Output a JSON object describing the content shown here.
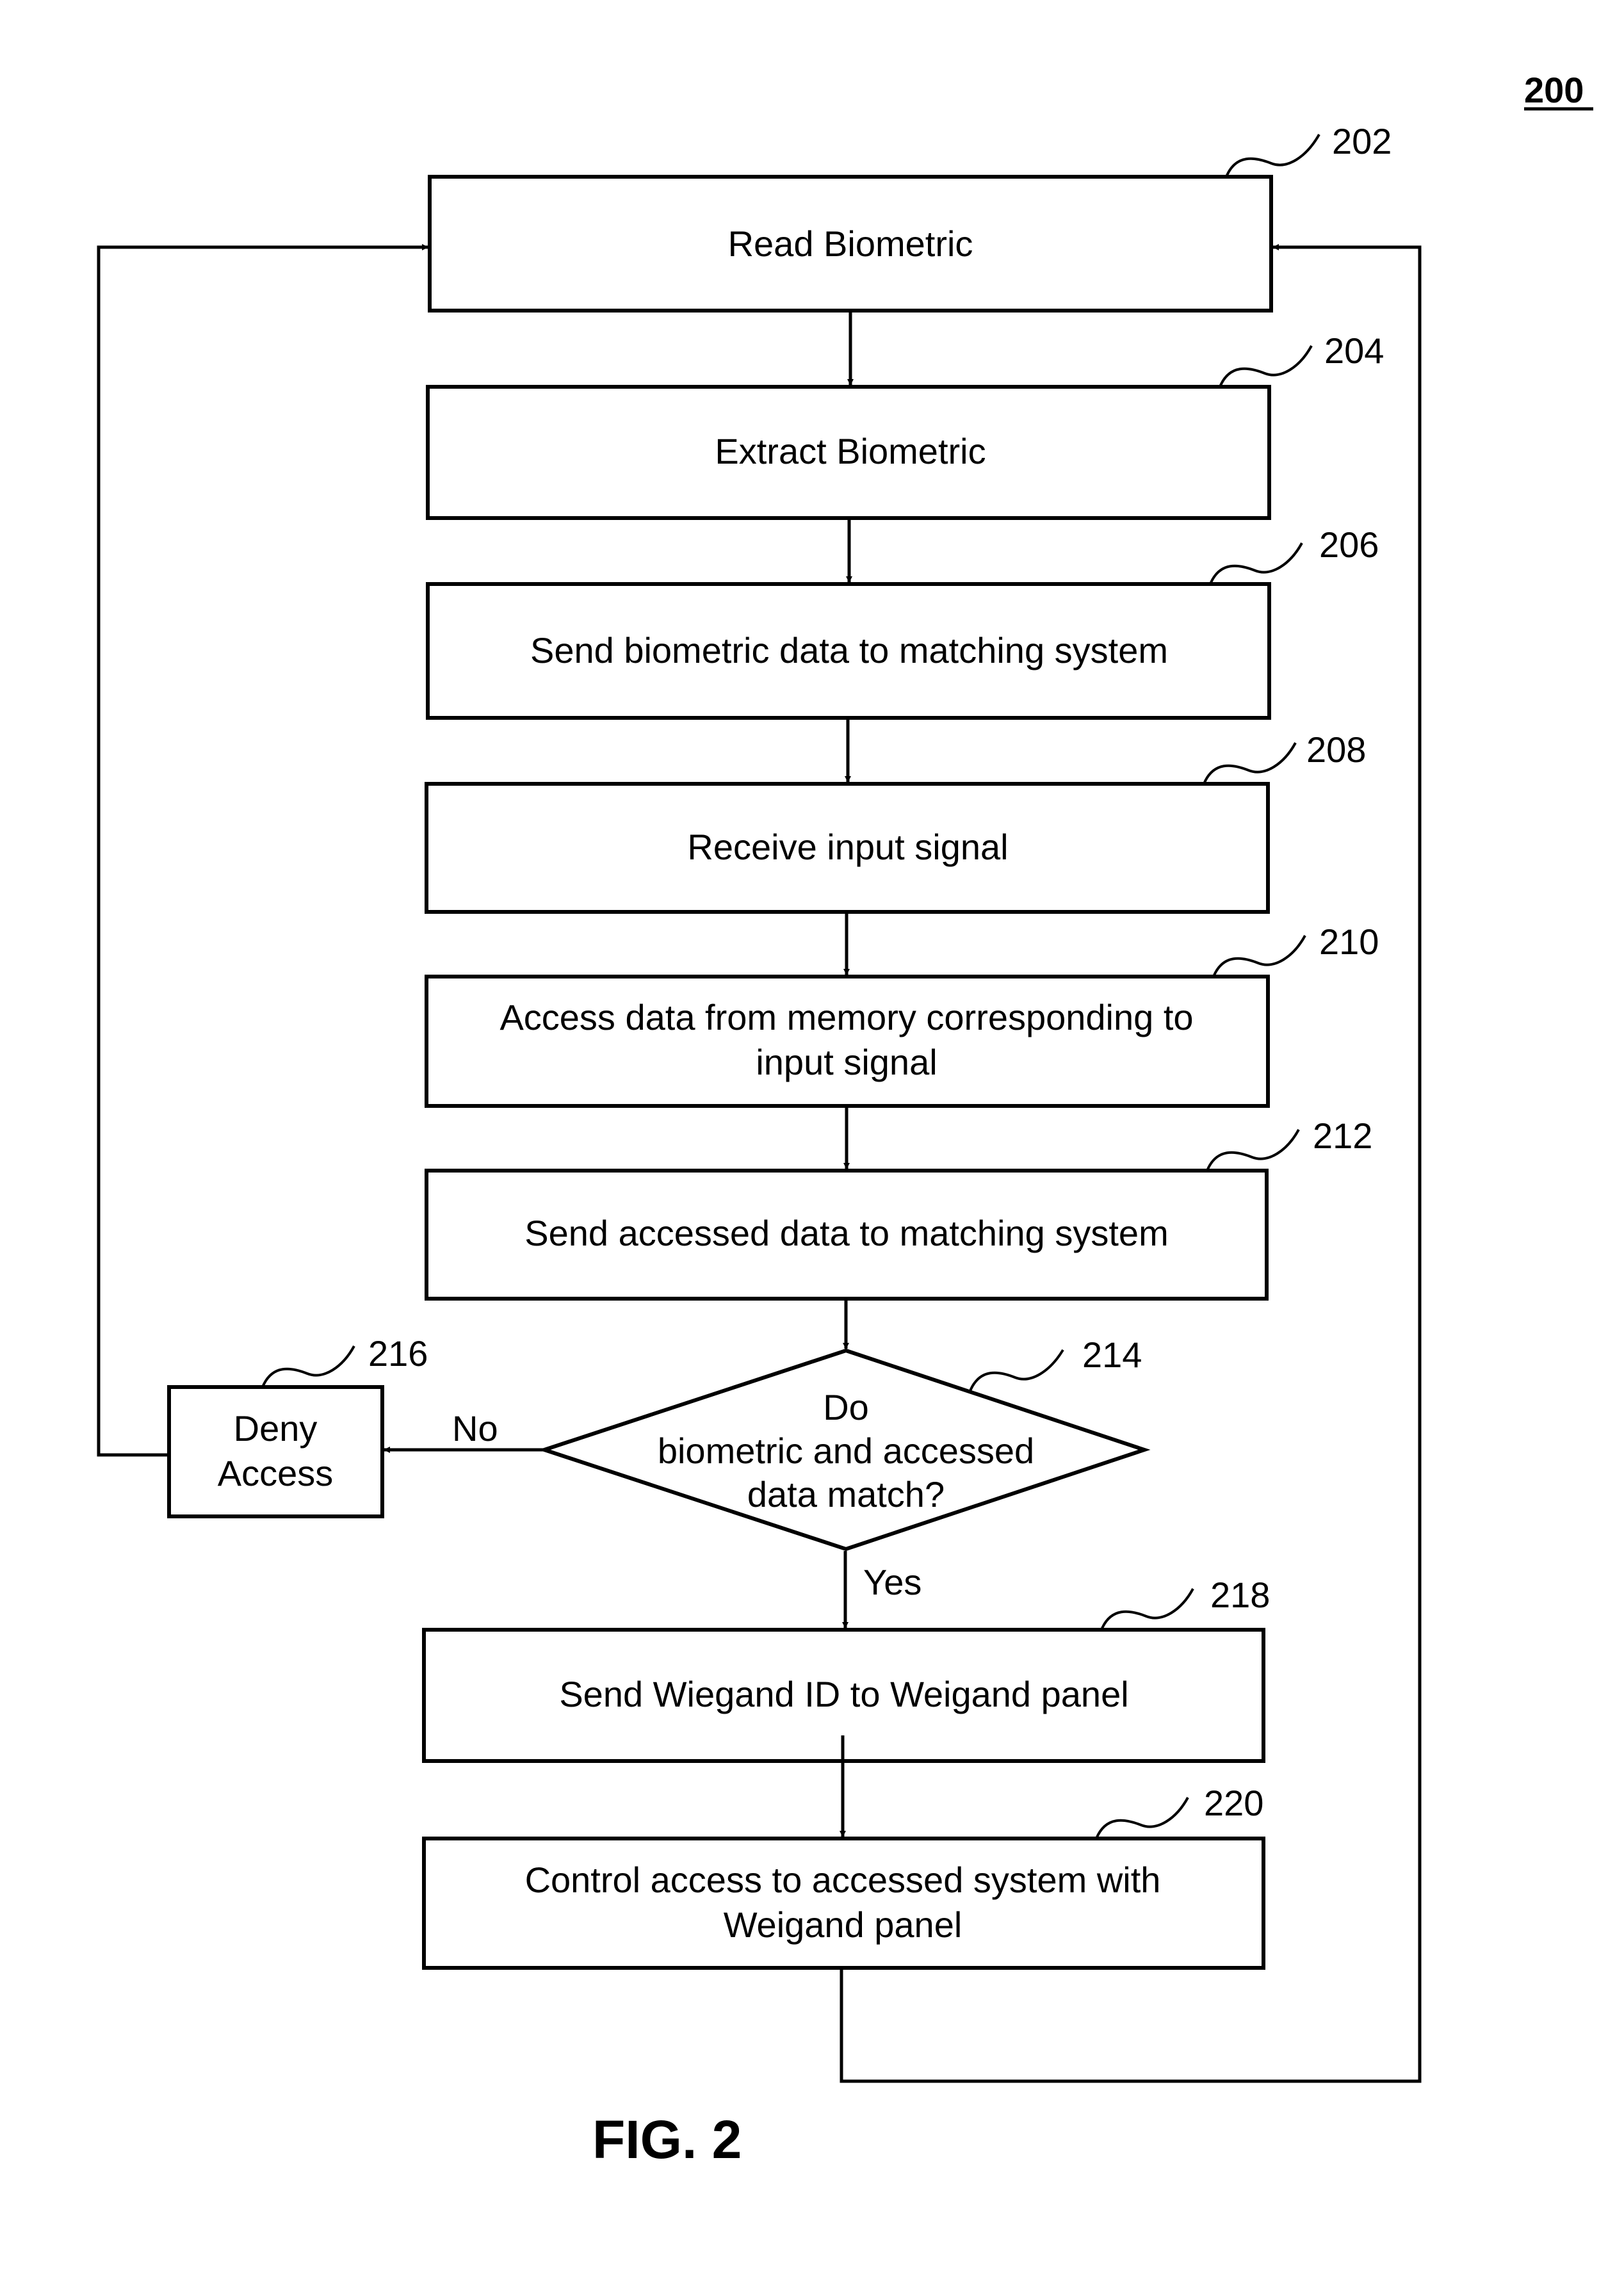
{
  "figure": {
    "number_label": "200",
    "caption": "FIG. 2"
  },
  "steps": [
    {
      "id": "202",
      "ref": "202",
      "lines": [
        "Read Biometric"
      ]
    },
    {
      "id": "204",
      "ref": "204",
      "lines": [
        "Extract Biometric"
      ]
    },
    {
      "id": "206",
      "ref": "206",
      "lines": [
        "Send biometric data to matching system"
      ]
    },
    {
      "id": "208",
      "ref": "208",
      "lines": [
        "Receive input signal"
      ]
    },
    {
      "id": "210",
      "ref": "210",
      "lines": [
        "Access data from memory corresponding to",
        "input signal"
      ]
    },
    {
      "id": "212",
      "ref": "212",
      "lines": [
        "Send accessed data to matching system"
      ]
    },
    {
      "id": "218",
      "ref": "218",
      "lines": [
        "Send Wiegand ID to Weigand panel"
      ]
    },
    {
      "id": "220",
      "ref": "220",
      "lines": [
        "Control access to accessed system with",
        "Weigand panel"
      ]
    }
  ],
  "decision": {
    "ref": "214",
    "lines": [
      "Do",
      "biometric and accessed",
      "data match?"
    ],
    "yes_label": "Yes",
    "no_label": "No"
  },
  "deny": {
    "ref": "216",
    "lines": [
      "Deny",
      "Access"
    ]
  },
  "edges": [
    {
      "from": "202",
      "to": "204"
    },
    {
      "from": "204",
      "to": "206"
    },
    {
      "from": "206",
      "to": "208"
    },
    {
      "from": "208",
      "to": "210"
    },
    {
      "from": "210",
      "to": "212"
    },
    {
      "from": "212",
      "to": "214"
    },
    {
      "from": "214",
      "to": "218",
      "label": "Yes"
    },
    {
      "from": "214",
      "to": "216",
      "label": "No"
    },
    {
      "from": "218",
      "to": "220"
    },
    {
      "from": "216",
      "to": "202"
    },
    {
      "from": "220",
      "to": "202"
    }
  ]
}
